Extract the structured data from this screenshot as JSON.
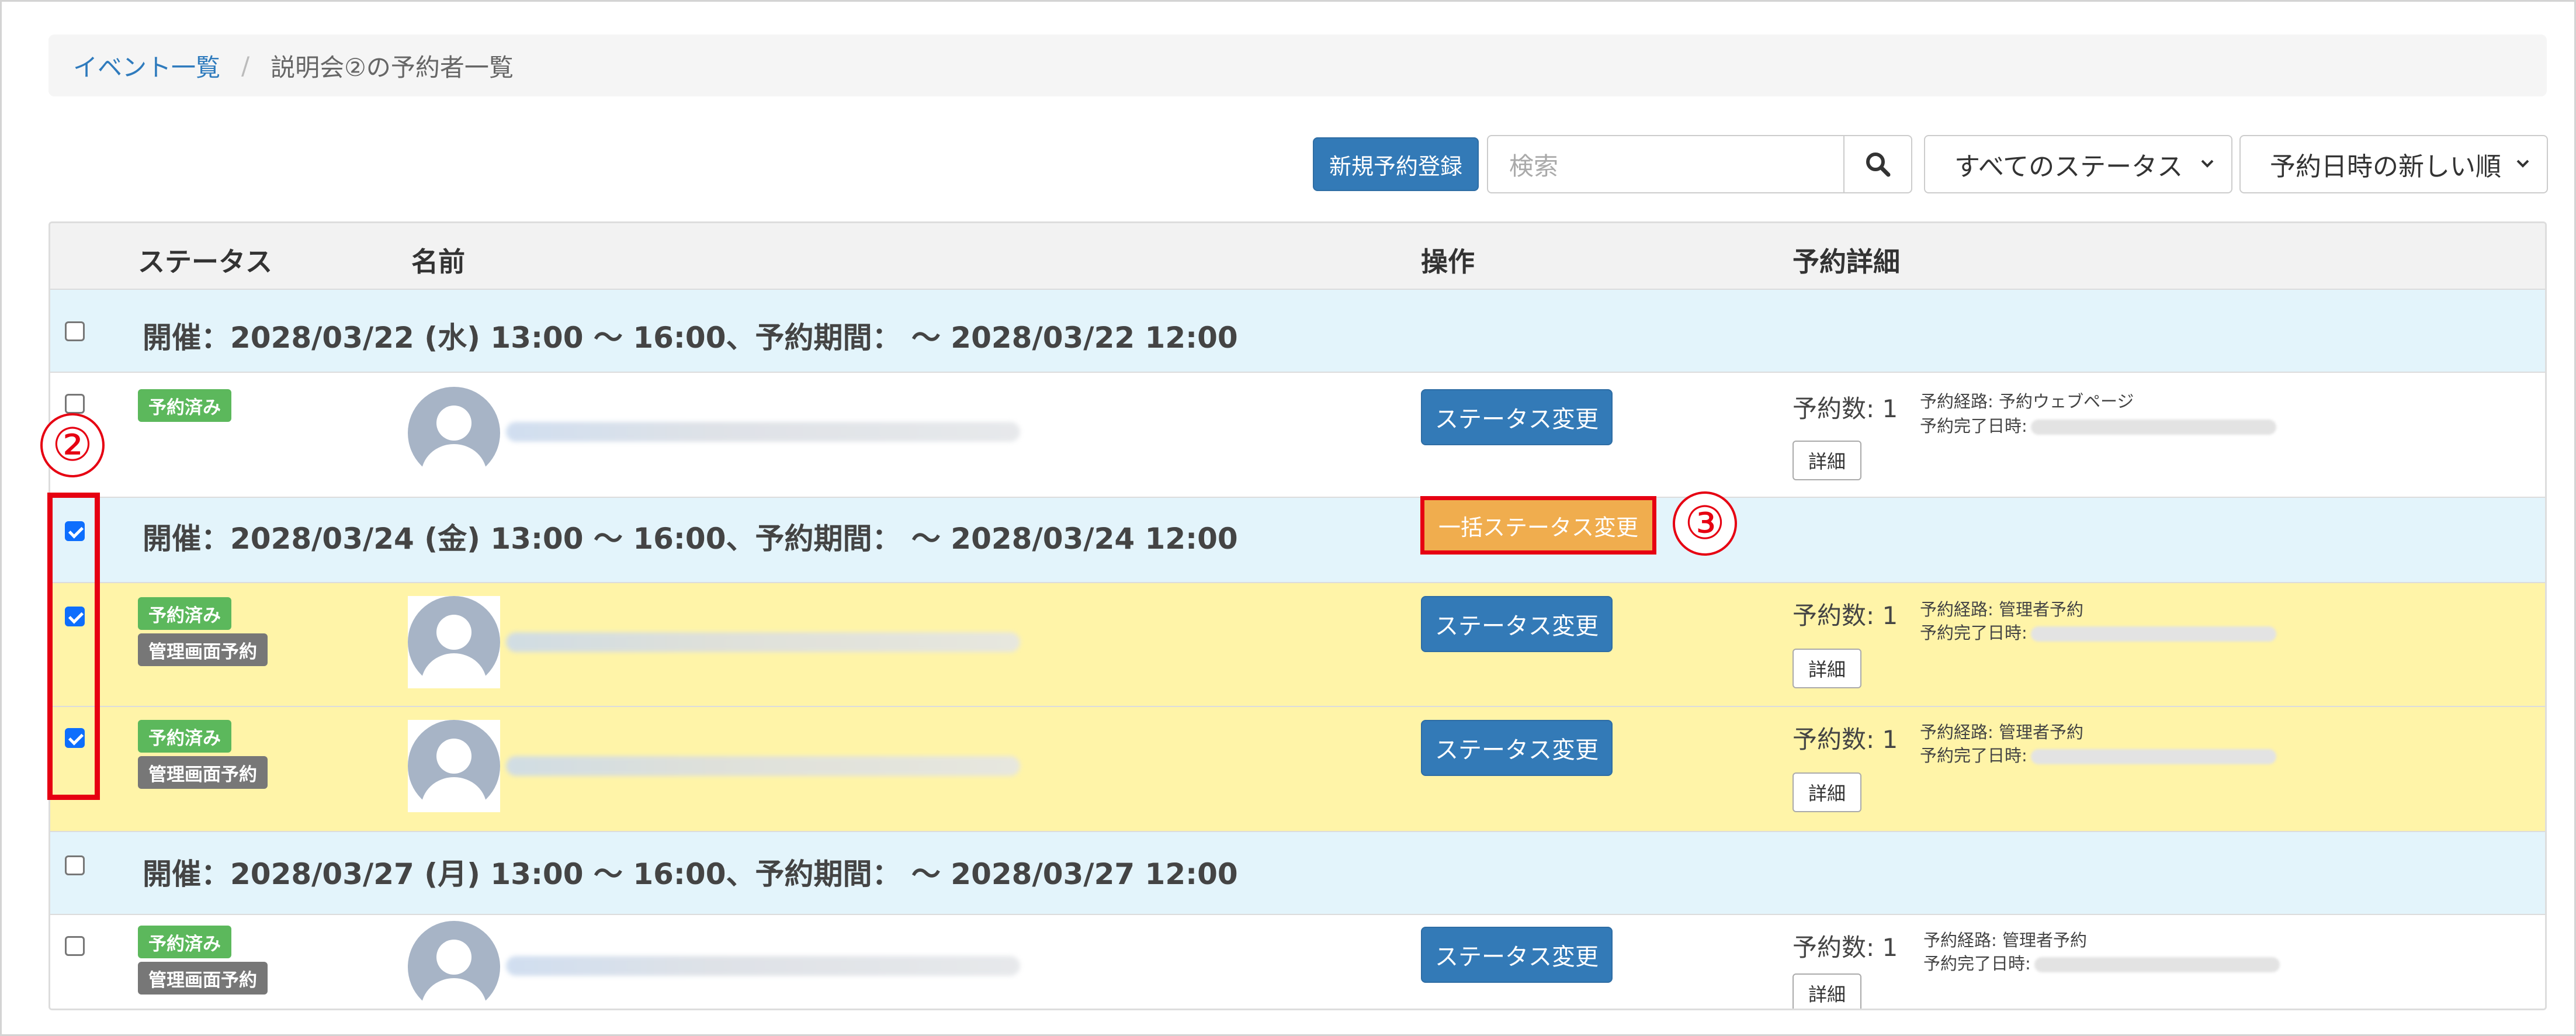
{
  "breadcrumb": {
    "link": "イベント一覧",
    "separator": "/",
    "current": "説明会②の予約者一覧"
  },
  "toolbar": {
    "new_button": "新規予約登録",
    "search_placeholder": "検索",
    "status_filter": "すべてのステータス",
    "sort_order": "予約日時の新しい順"
  },
  "table": {
    "headers": {
      "status": "ステータス",
      "name": "名前",
      "action": "操作",
      "detail": "予約詳細"
    },
    "groups": [
      {
        "title": "開催：2028/03/22 (水) 13:00 ～ 16:00、予約期間： ～ 2028/03/22 12:00",
        "checked": false,
        "rows": [
          {
            "checked": false,
            "badges": [
              "予約済み"
            ],
            "count": "予約数: 1",
            "route": "予約経路: 予約ウェブページ",
            "done": "予約完了日時:"
          }
        ]
      },
      {
        "title": "開催：2028/03/24 (金) 13:00 ～ 16:00、予約期間： ～ 2028/03/24 12:00",
        "checked": true,
        "bulk_button": "一括ステータス変更",
        "rows": [
          {
            "checked": true,
            "badges": [
              "予約済み",
              "管理画面予約"
            ],
            "count": "予約数: 1",
            "route": "予約経路: 管理者予約",
            "done": "予約完了日時:"
          },
          {
            "checked": true,
            "badges": [
              "予約済み",
              "管理画面予約"
            ],
            "count": "予約数: 1",
            "route": "予約経路: 管理者予約",
            "done": "予約完了日時:"
          }
        ]
      },
      {
        "title": "開催：2028/03/27 (月) 13:00 ～ 16:00、予約期間： ～ 2028/03/27 12:00",
        "checked": false,
        "rows": [
          {
            "checked": false,
            "badges": [
              "予約済み",
              "管理画面予約"
            ],
            "count": "予約数: 1",
            "route": "予約経路: 管理者予約",
            "done": "予約完了日時:"
          }
        ]
      }
    ],
    "status_change_label": "ステータス変更",
    "detail_label": "詳細"
  },
  "annotations": {
    "marker_2": "②",
    "marker_3": "③"
  },
  "colors": {
    "primary": "#337ab7",
    "success": "#5cb85c",
    "warning": "#f0ad4e",
    "highlight": "#e60012",
    "group_bg": "#e3f4fb",
    "selected_bg": "#fff4a8"
  }
}
